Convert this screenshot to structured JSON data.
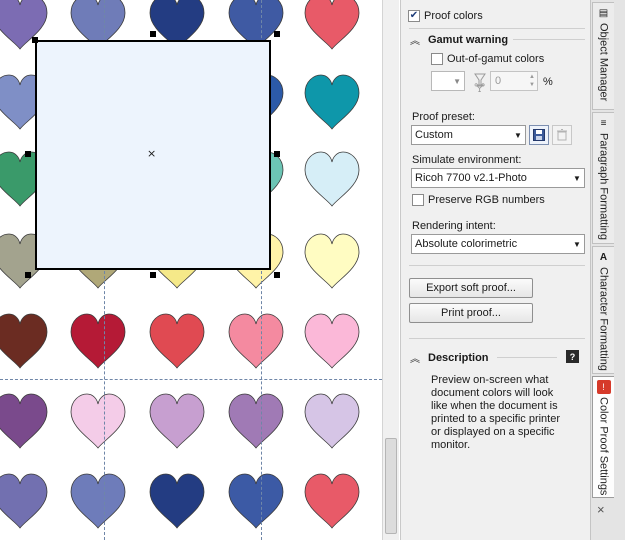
{
  "proof": {
    "proof_colors_label": "Proof colors",
    "proof_colors_checked": true
  },
  "gamut": {
    "title": "Gamut warning",
    "out_of_gamut_label": "Out-of-gamut colors",
    "opacity_value": "0",
    "percent": "%"
  },
  "preset": {
    "label": "Proof preset:",
    "value": "Custom"
  },
  "environment": {
    "label": "Simulate environment:",
    "value": "Ricoh 7700 v2.1-Photo",
    "preserve_rgb_label": "Preserve RGB numbers"
  },
  "rendering": {
    "label": "Rendering intent:",
    "value": "Absolute colorimetric"
  },
  "buttons": {
    "export": "Export soft proof...",
    "print": "Print proof..."
  },
  "description": {
    "title": "Description",
    "text": "Preview on-screen what document colors will look like when the document is printed to a specific printer or displayed on a specific monitor."
  },
  "tabs": [
    {
      "label": "Object Manager"
    },
    {
      "label": "Paragraph Formatting"
    },
    {
      "label": "Character Formatting"
    },
    {
      "label": "Color Proof Settings"
    }
  ],
  "icons": {
    "close": "×",
    "chevron_up": "▲",
    "dropdown_arrow": "▼"
  },
  "colors": {
    "accent": "#1f3d7a",
    "rect_fill": "#edf4fd"
  },
  "canvas": {
    "hearts": [
      [
        "#7c6cb3",
        "#6f7cb8",
        "#233c82",
        "#3f5aa3",
        "#e85a68"
      ],
      [
        "#7f8fc6",
        "#6a7cc0",
        "#2c4a98",
        "#2c5aa8",
        "#0e97aa"
      ],
      [
        "#3a9a6a",
        "#5bb08a",
        "#41a890",
        "#6cc5b5",
        "#d6eef7"
      ],
      [
        "#a3a38e",
        "#b0a878",
        "#f5e989",
        "#fff3a8",
        "#fffcc2"
      ],
      [
        "#6b2c22",
        "#b51a36",
        "#e04a52",
        "#f48aa0",
        "#fbb8d8"
      ],
      [
        "#7a4a8c",
        "#f4cce8",
        "#c79fd0",
        "#a07ab5",
        "#d6c5e6"
      ],
      [
        "#7270b0",
        "#6e7cba",
        "#233c82",
        "#3c5aa5",
        "#e85a68"
      ]
    ]
  }
}
